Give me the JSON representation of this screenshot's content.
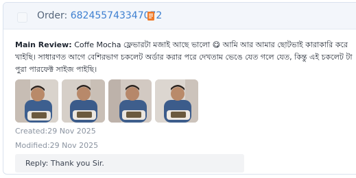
{
  "order": {
    "label": "Order:",
    "id": "682455743347072"
  },
  "review": {
    "label": "Main Review:",
    "text": "Coffe Mocha ফ্লেভারটা মজাই আছে ভালো 😋 আমি আর আমার ছোটভাই কারাকারি করে খাইছি। সাধারণত আগে বেশিরভাগ চকলেট অর্ডার করার পরে দেখতাম ভেঙে যেত গলে যেত, কিন্তু এই চকলেট টা পুরা পারফেক্ট সাইজ পাইছি।"
  },
  "images": [
    {
      "alt": "review-photo-1"
    },
    {
      "alt": "review-photo-2"
    },
    {
      "alt": "review-photo-3"
    },
    {
      "alt": "review-photo-4"
    }
  ],
  "created": "Created:29 Nov 2025",
  "modified": "Modified:29 Nov 2025",
  "reply": "Reply: Thank you Sir.",
  "colors": {
    "order_id": "#3d7fd0",
    "copy_icon": "#f07a2a",
    "header_bg": "#f3f6fb"
  }
}
